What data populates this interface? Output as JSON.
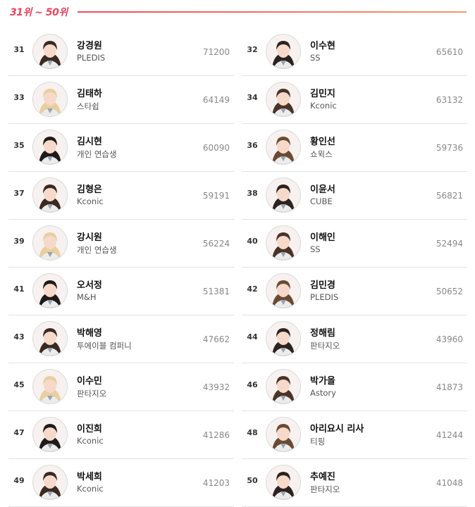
{
  "section": {
    "title": "31위 ~ 50위"
  },
  "colors": {
    "accent": "#e8455d",
    "divider": "#e3e3e3"
  },
  "trainees": [
    {
      "rank": "31",
      "name": "강경원",
      "agency": "PLEDIS",
      "score": "71200"
    },
    {
      "rank": "32",
      "name": "이수현",
      "agency": "SS",
      "score": "65610"
    },
    {
      "rank": "33",
      "name": "김태하",
      "agency": "스타쉽",
      "score": "64149"
    },
    {
      "rank": "34",
      "name": "김민지",
      "agency": "Kconic",
      "score": "63132"
    },
    {
      "rank": "35",
      "name": "김시현",
      "agency": "개인 연습생",
      "score": "60090"
    },
    {
      "rank": "36",
      "name": "황인선",
      "agency": "쇼윅스",
      "score": "59736"
    },
    {
      "rank": "37",
      "name": "김형은",
      "agency": "Kconic",
      "score": "59191"
    },
    {
      "rank": "38",
      "name": "이윤서",
      "agency": "CUBE",
      "score": "56821"
    },
    {
      "rank": "39",
      "name": "강시원",
      "agency": "개인 연습생",
      "score": "56224"
    },
    {
      "rank": "40",
      "name": "이해인",
      "agency": "SS",
      "score": "52494"
    },
    {
      "rank": "41",
      "name": "오서정",
      "agency": "M&H",
      "score": "51381"
    },
    {
      "rank": "42",
      "name": "김민경",
      "agency": "PLEDIS",
      "score": "50652"
    },
    {
      "rank": "43",
      "name": "박해영",
      "agency": "투에이블 컴퍼니",
      "score": "47662"
    },
    {
      "rank": "44",
      "name": "정해림",
      "agency": "판타지오",
      "score": "43960"
    },
    {
      "rank": "45",
      "name": "이수민",
      "agency": "판타지오",
      "score": "43932"
    },
    {
      "rank": "46",
      "name": "박가을",
      "agency": "Astory",
      "score": "41873"
    },
    {
      "rank": "47",
      "name": "이진희",
      "agency": "Kconic",
      "score": "41286"
    },
    {
      "rank": "48",
      "name": "아리요시 리사",
      "agency": "티핑",
      "score": "41244"
    },
    {
      "rank": "49",
      "name": "박세희",
      "agency": "Kconic",
      "score": "41203"
    },
    {
      "rank": "50",
      "name": "추예진",
      "agency": "판타지오",
      "score": "41048"
    }
  ]
}
